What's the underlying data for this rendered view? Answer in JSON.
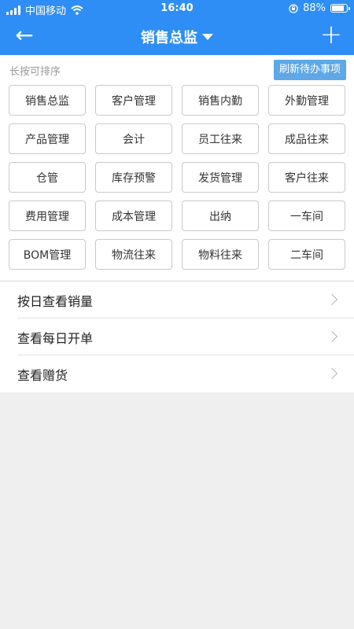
{
  "status_bar": {
    "carrier": "中国移动",
    "time": "16:40",
    "battery": "88%",
    "icons": [
      "signal-icon",
      "wifi-icon",
      "orientation-lock-icon",
      "battery-icon"
    ]
  },
  "navbar": {
    "back_icon": "←",
    "title": "销售总监",
    "add_icon": "+"
  },
  "panel": {
    "hint": "长按可排序",
    "refresh_label": "刷新待办事项",
    "modules": [
      "销售总监",
      "客户管理",
      "销售内勤",
      "外勤管理",
      "产品管理",
      "会计",
      "员工往来",
      "成品往来",
      "仓管",
      "库存预警",
      "发货管理",
      "客户往来",
      "费用管理",
      "成本管理",
      "出纳",
      "一车间",
      "BOM管理",
      "物流往来",
      "物料往来",
      "二车间"
    ]
  },
  "list": {
    "items": [
      "按日查看销量",
      "查看每日开单",
      "查看赠货"
    ]
  },
  "colors": {
    "header": "#2e8ef5",
    "refresh_button": "#5fa8e8",
    "background": "#efefef"
  }
}
